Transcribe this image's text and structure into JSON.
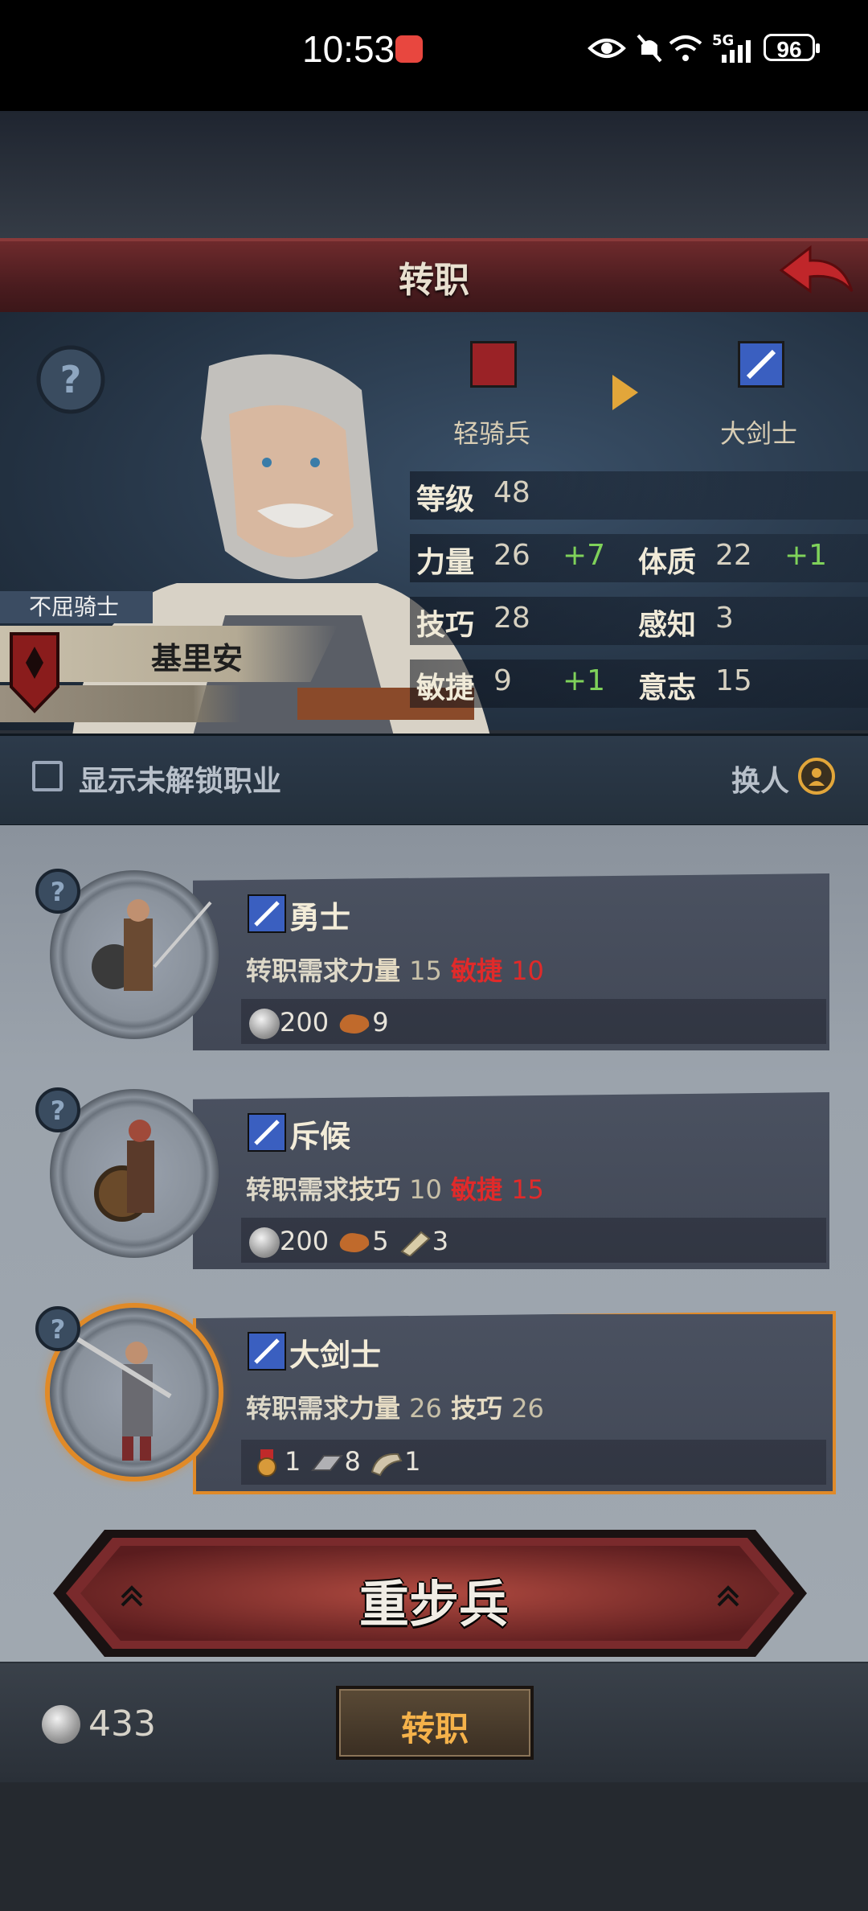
{
  "status_bar": {
    "time": "10:53",
    "battery": "96",
    "signal": "5G"
  },
  "header": {
    "title": "转职"
  },
  "hero": {
    "title_tag": "不屈骑士",
    "name": "基里安",
    "from_class": "轻骑兵",
    "to_class": "大剑士",
    "stats": {
      "level_label": "等级",
      "level": "48",
      "str_label": "力量",
      "str": "26",
      "str_bonus": "+7",
      "con_label": "体质",
      "con": "22",
      "con_bonus": "+1",
      "skill_label": "技巧",
      "skill": "28",
      "per_label": "感知",
      "per": "3",
      "agi_label": "敏捷",
      "agi": "9",
      "agi_bonus": "+1",
      "will_label": "意志",
      "will": "15"
    }
  },
  "options": {
    "show_locked_label": "显示未解锁职业",
    "swap_label": "换人"
  },
  "classes": [
    {
      "name": "勇士",
      "req_prefix": "转职需求",
      "req": [
        {
          "label": "力量",
          "value": "15",
          "met": true
        },
        {
          "label": "敏捷",
          "value": "10",
          "met": false
        }
      ],
      "cost": [
        {
          "icon": "silver-coin-icon",
          "amount": "200"
        },
        {
          "icon": "leather-icon",
          "amount": "9"
        }
      ],
      "selected": false
    },
    {
      "name": "斥候",
      "req_prefix": "转职需求",
      "req": [
        {
          "label": "技巧",
          "value": "10",
          "met": true
        },
        {
          "label": "敏捷",
          "value": "15",
          "met": false
        }
      ],
      "cost": [
        {
          "icon": "silver-coin-icon",
          "amount": "200"
        },
        {
          "icon": "leather-icon",
          "amount": "5"
        },
        {
          "icon": "cloth-roll-icon",
          "amount": "3"
        }
      ],
      "selected": false
    },
    {
      "name": "大剑士",
      "req_prefix": "转职需求",
      "req": [
        {
          "label": "力量",
          "value": "26",
          "met": true
        },
        {
          "label": "技巧",
          "value": "26",
          "met": true
        }
      ],
      "cost": [
        {
          "icon": "medal-icon",
          "amount": "1"
        },
        {
          "icon": "iron-ingot-icon",
          "amount": "8"
        },
        {
          "icon": "fur-icon",
          "amount": "1"
        }
      ],
      "selected": true
    }
  ],
  "big_button": {
    "label": "重步兵"
  },
  "bottom": {
    "gold": "433",
    "confirm_label": "转职"
  },
  "colors": {
    "accent_orange": "#e08a28",
    "bonus_green": "#7fd25a",
    "warning_red": "#e02a2a",
    "title_red": "#6e2a2c"
  }
}
